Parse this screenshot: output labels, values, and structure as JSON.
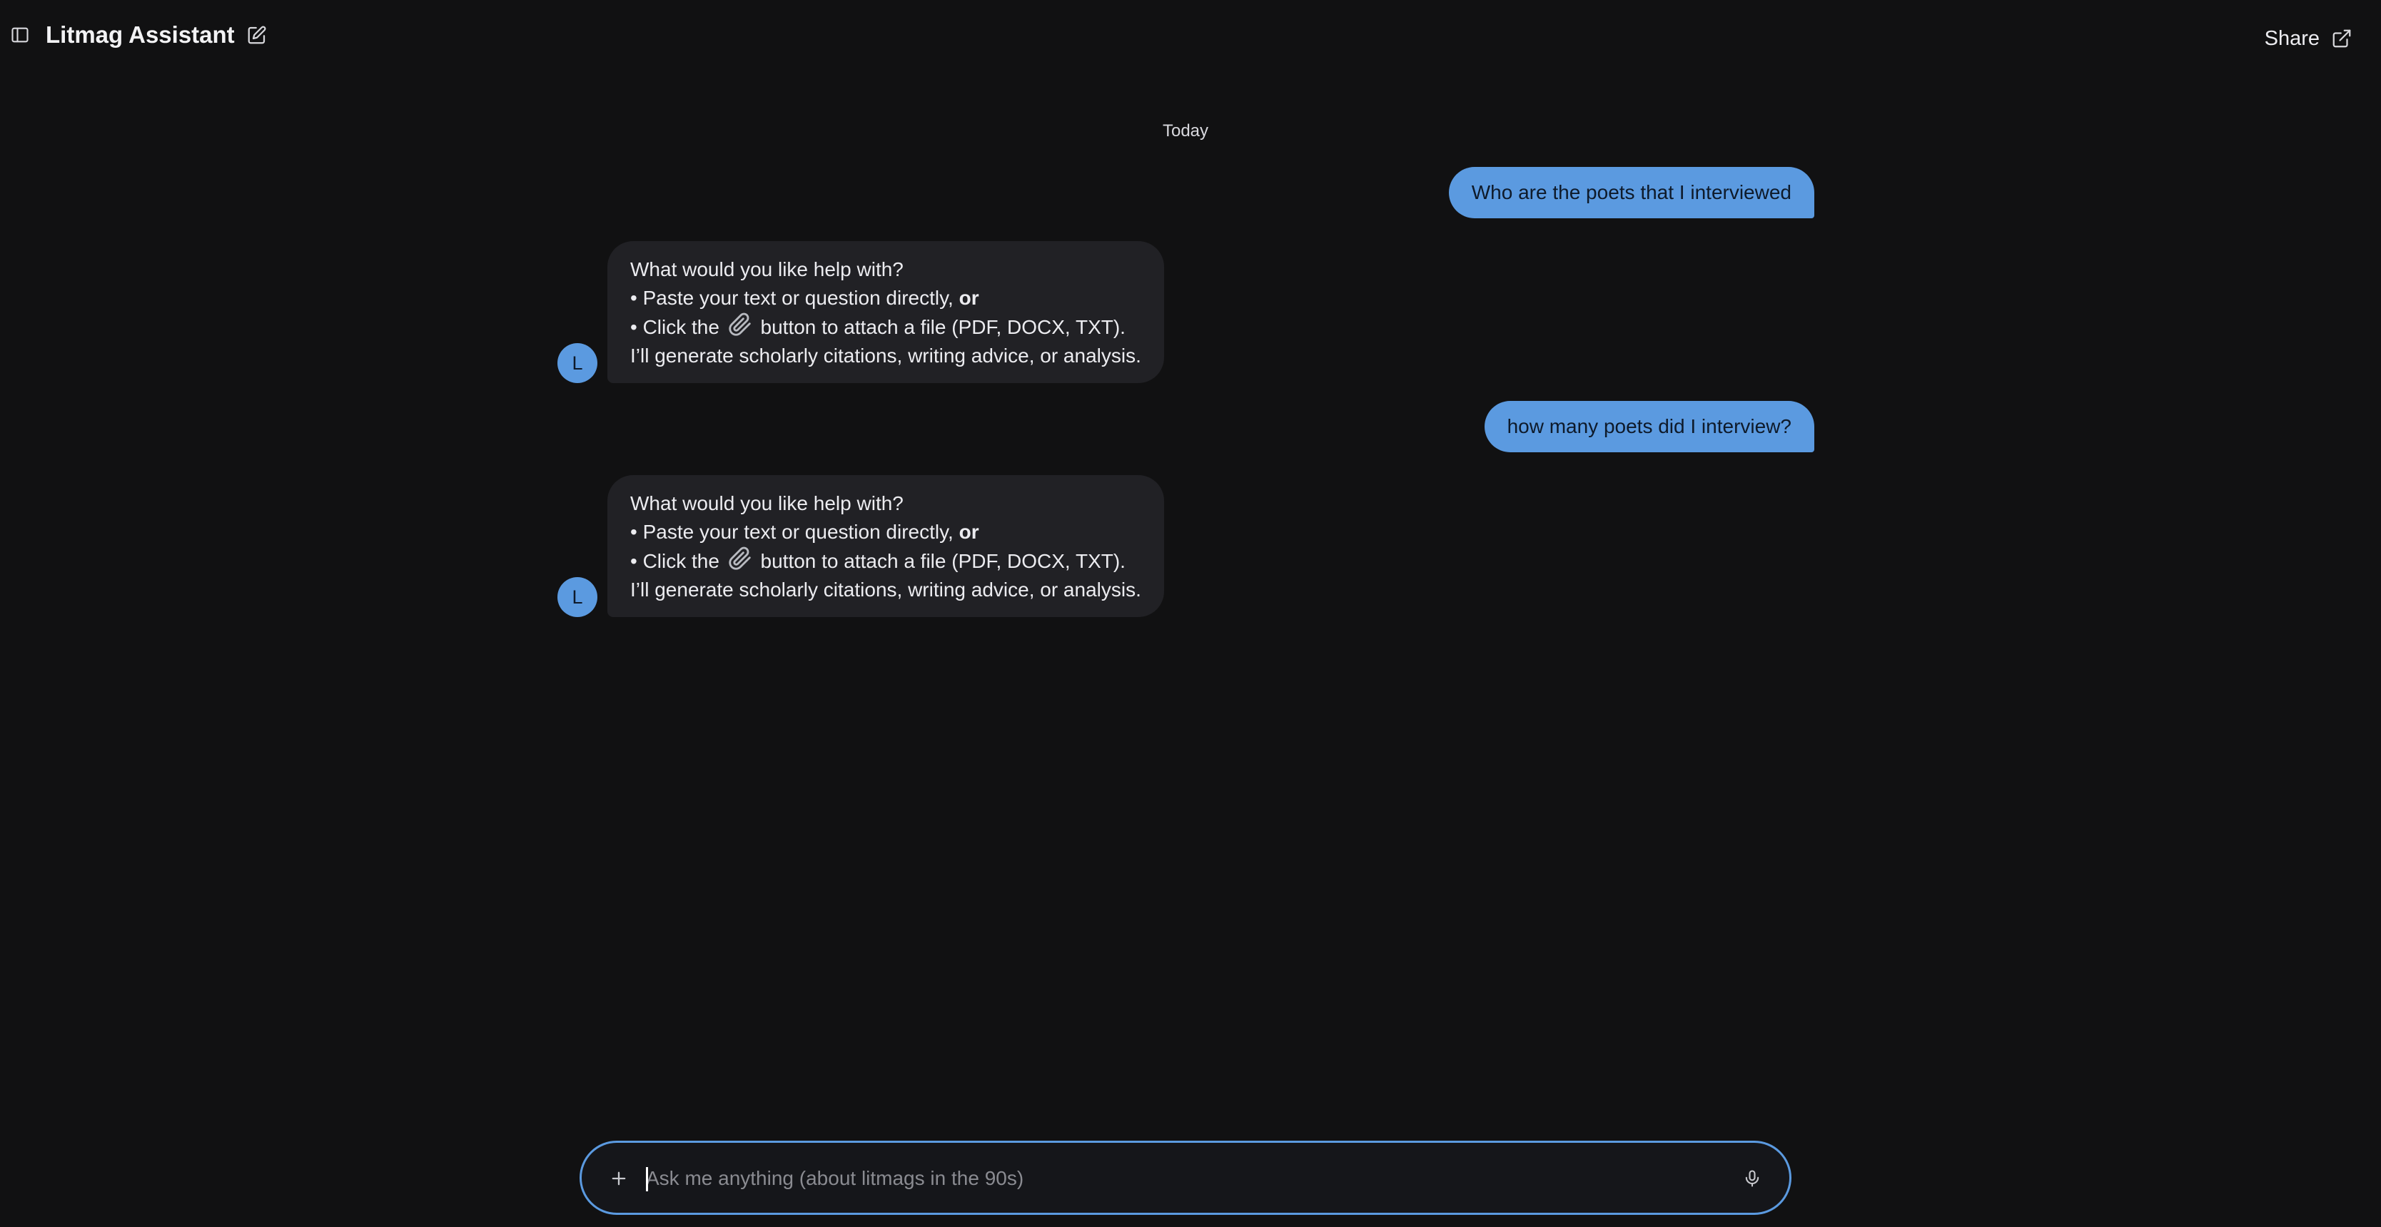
{
  "header": {
    "title": "Litmag Assistant",
    "share_label": "Share"
  },
  "chat": {
    "day_separator": "Today",
    "bot_avatar_letter": "L",
    "messages": [
      {
        "role": "user",
        "text": "Who are the poets that I interviewed"
      },
      {
        "role": "assistant",
        "line1": "What would you like help with?",
        "line2_prefix": "• Paste your text or question directly, ",
        "line2_bold": "or",
        "line3_prefix": "• Click the ",
        "line3_suffix": " button to attach a file (PDF, DOCX, TXT).",
        "line4": "I’ll generate scholarly citations, writing advice, or analysis."
      },
      {
        "role": "user",
        "text": "how many poets did I interview?"
      },
      {
        "role": "assistant",
        "line1": "What would you like help with?",
        "line2_prefix": "• Paste your text or question directly, ",
        "line2_bold": "or",
        "line3_prefix": "• Click the ",
        "line3_suffix": " button to attach a file (PDF, DOCX, TXT).",
        "line4": "I’ll generate scholarly citations, writing advice, or analysis."
      }
    ]
  },
  "composer": {
    "placeholder": "Ask me anything (about litmags in the 90s)",
    "value": ""
  },
  "icons": {
    "sidebar": "sidebar-toggle-icon",
    "new_chat": "edit-icon",
    "share": "external-link-icon",
    "attach": "paperclip-icon",
    "plus": "plus-icon",
    "mic": "microphone-icon"
  },
  "colors": {
    "background": "#111112",
    "user_bubble": "#5b9ae0",
    "bot_bubble": "#212125",
    "composer_border": "#5b9ae0"
  }
}
